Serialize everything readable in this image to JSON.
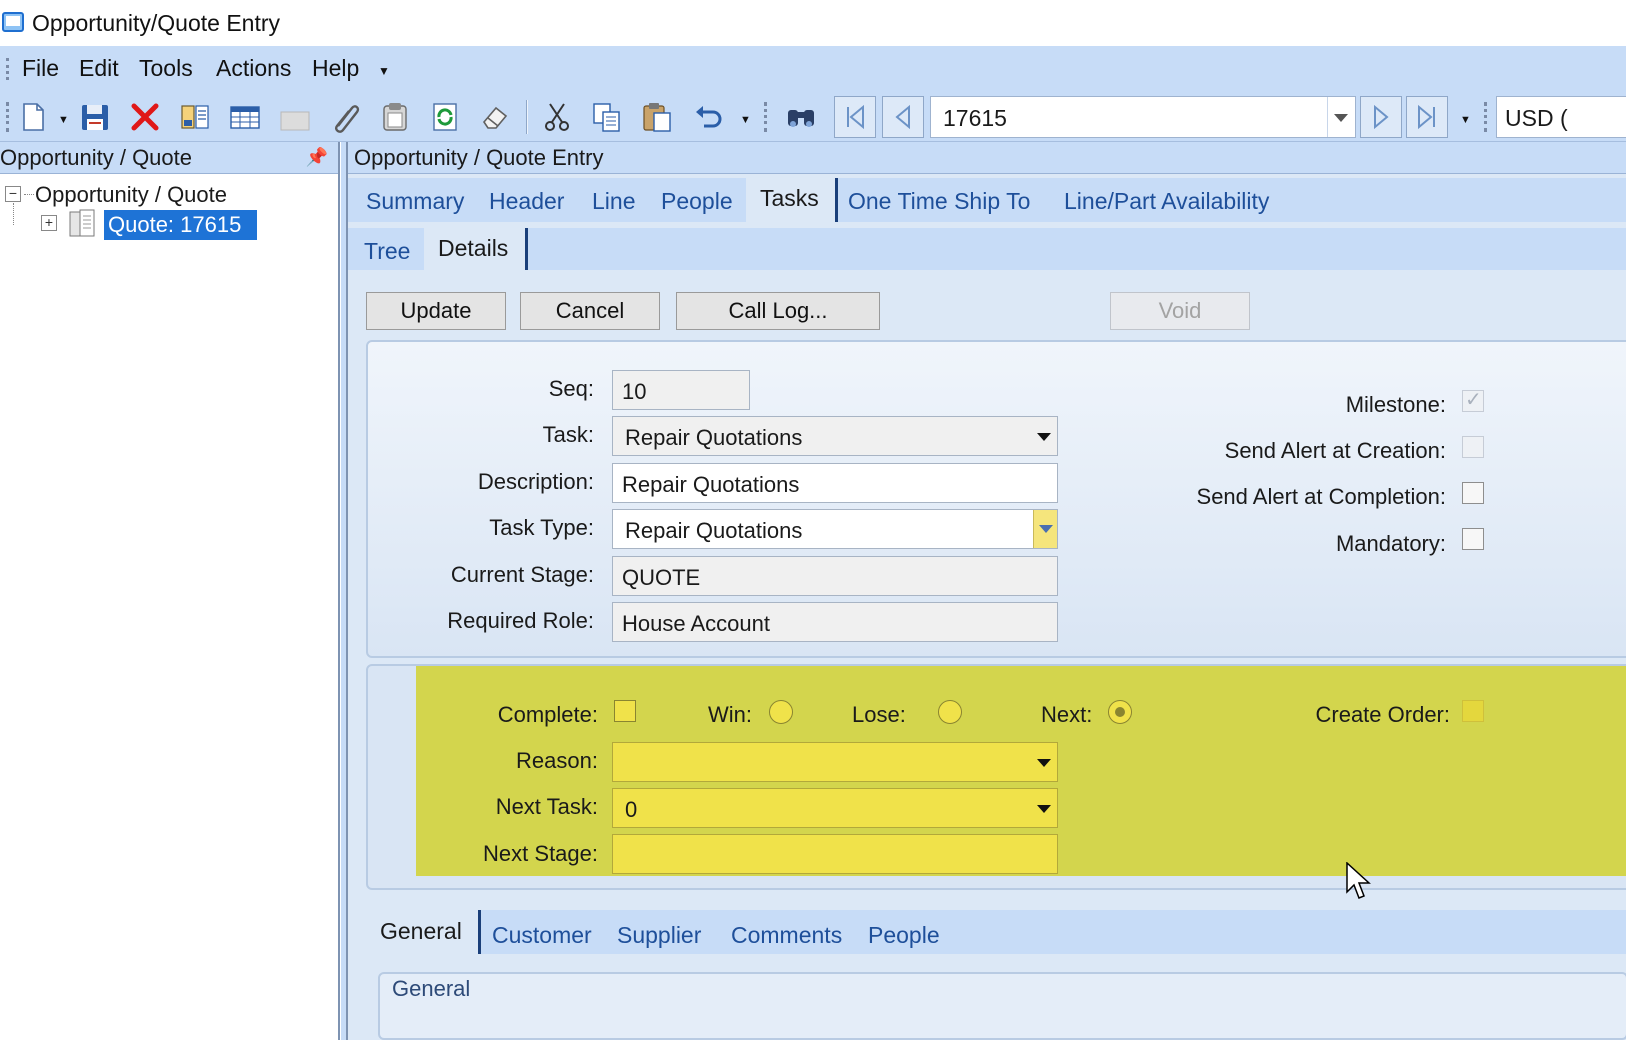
{
  "window": {
    "title": "Opportunity/Quote Entry"
  },
  "menu": {
    "items": [
      "File",
      "Edit",
      "Tools",
      "Actions",
      "Help"
    ]
  },
  "toolbar": {
    "icons": [
      "new-icon",
      "save-icon",
      "delete-icon",
      "book-icon",
      "grid-icon",
      "blank-icon",
      "attach-icon",
      "clipboard-icon",
      "refresh-icon",
      "eraser-icon",
      "cut-icon",
      "copy-icon",
      "paste-icon",
      "undo-icon",
      "find-icon"
    ],
    "record_value": "17615",
    "currency": "USD ("
  },
  "left_panel": {
    "header": "Opportunity / Quote",
    "tree_root": "Opportunity / Quote",
    "tree_child": "Quote: 17615"
  },
  "content": {
    "header": "Opportunity / Quote Entry",
    "main_tabs": [
      "Summary",
      "Header",
      "Line",
      "People",
      "Tasks",
      "One Time Ship To",
      "Line/Part Availability"
    ],
    "active_main_tab": "Tasks",
    "sub_tabs": [
      "Tree",
      "Details"
    ],
    "active_sub_tab": "Details",
    "buttons": {
      "update": "Update",
      "cancel": "Cancel",
      "call_log": "Call Log...",
      "void": "Void"
    },
    "details": {
      "seq_label": "Seq:",
      "seq_value": "10",
      "task_label": "Task:",
      "task_value": "Repair Quotations",
      "description_label": "Description:",
      "description_value": "Repair Quotations",
      "task_type_label": "Task Type:",
      "task_type_value": "Repair Quotations",
      "current_stage_label": "Current Stage:",
      "current_stage_value": "QUOTE",
      "required_role_label": "Required Role:",
      "required_role_value": "House Account",
      "milestone_label": "Milestone:",
      "milestone_checked": true,
      "send_alert_creation_label": "Send Alert at Creation:",
      "send_alert_creation_checked": false,
      "send_alert_completion_label": "Send Alert at Completion:",
      "send_alert_completion_checked": false,
      "mandatory_label": "Mandatory:",
      "mandatory_checked": false
    },
    "status": {
      "complete_label": "Complete:",
      "complete_checked": false,
      "win_label": "Win:",
      "lose_label": "Lose:",
      "next_label": "Next:",
      "selected_outcome": "Next",
      "create_order_label": "Create Order:",
      "create_order_checked": false,
      "reason_label": "Reason:",
      "reason_value": "",
      "next_task_label": "Next Task:",
      "next_task_value": "0",
      "next_stage_label": "Next Stage:",
      "next_stage_value": ""
    },
    "bottom_tabs": [
      "General",
      "Customer",
      "Supplier",
      "Comments",
      "People"
    ],
    "active_bottom_tab": "General",
    "bottom_group_title": "General"
  },
  "colors": {
    "accent_blue": "#c7dcf7",
    "selection": "#1e73d6",
    "required_yellow": "#f0e24a",
    "highlight_panel": "#d3d54d"
  }
}
